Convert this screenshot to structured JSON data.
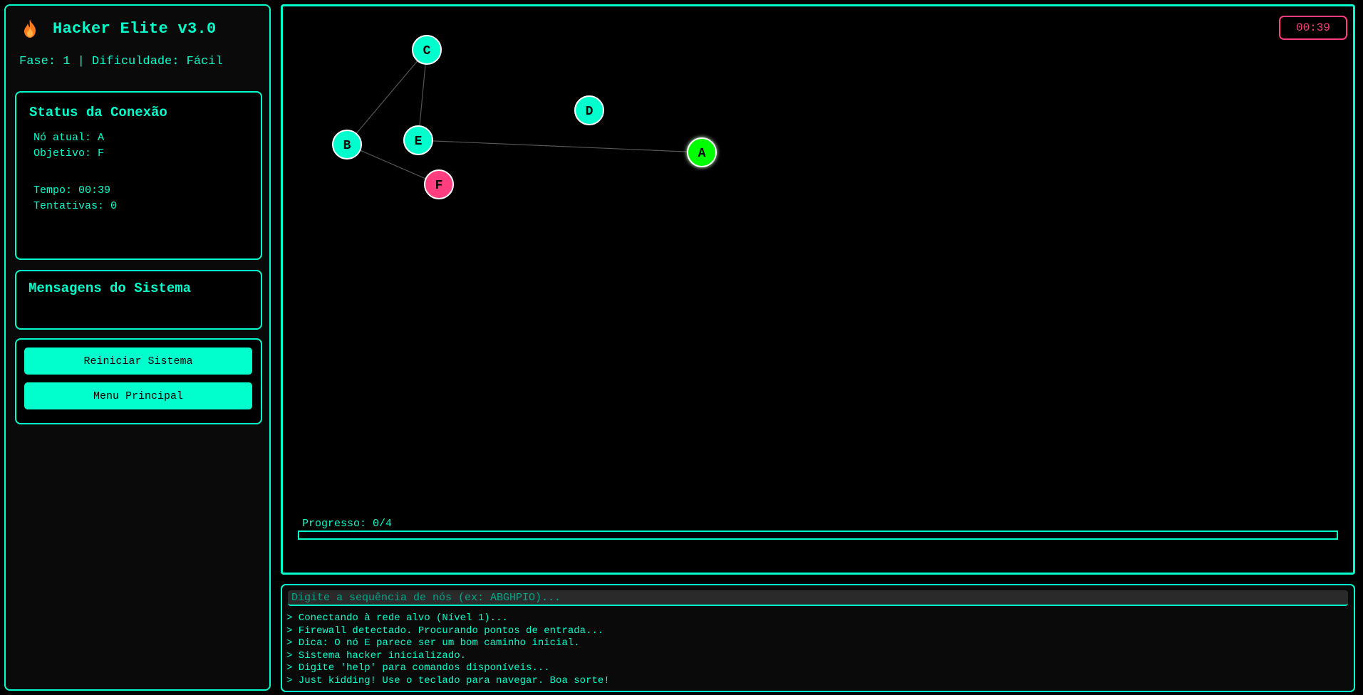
{
  "sidebar": {
    "title": "Hacker Elite v3.0",
    "title_icon": "flame-icon",
    "phase_info": "Fase: 1 | Dificuldade: Fácil",
    "status_panel": {
      "title": "Status da Conexão",
      "current_node": "Nó atual: A",
      "objective": "Objetivo: F",
      "time": "Tempo: 00:39",
      "attempts": "Tentativas: 0"
    },
    "messages_panel": {
      "title": "Mensagens do Sistema"
    },
    "buttons": {
      "restart": "Reiniciar Sistema",
      "menu": "Menu Principal"
    }
  },
  "game": {
    "timer": "00:39",
    "progress_label": "Progresso: 0/4",
    "progress": {
      "current": 0,
      "total": 4
    },
    "colors": {
      "node": "#00ffcc",
      "current": "#00ff00",
      "target": "#ff3d7f",
      "edge": "#555555"
    },
    "graph": {
      "nodes": [
        {
          "id": "C",
          "role": "normal"
        },
        {
          "id": "D",
          "role": "normal"
        },
        {
          "id": "B",
          "role": "normal"
        },
        {
          "id": "E",
          "role": "normal"
        },
        {
          "id": "A",
          "role": "current"
        },
        {
          "id": "F",
          "role": "target"
        }
      ],
      "edges": [
        [
          "C",
          "B"
        ],
        [
          "C",
          "E"
        ],
        [
          "E",
          "A"
        ],
        [
          "B",
          "F"
        ]
      ]
    }
  },
  "terminal": {
    "placeholder": "Digite a sequência de nós (ex: ABGHPIO)...",
    "input_value": "",
    "lines": [
      "> Conectando à rede alvo (Nível 1)...",
      "> Firewall detectado. Procurando pontos de entrada...",
      "> Dica: O nó E parece ser um bom caminho inicial.",
      "> Sistema hacker inicializado.",
      "> Digite 'help' para comandos disponíveis...",
      "> Just kidding! Use o teclado para navegar. Boa sorte!"
    ]
  }
}
